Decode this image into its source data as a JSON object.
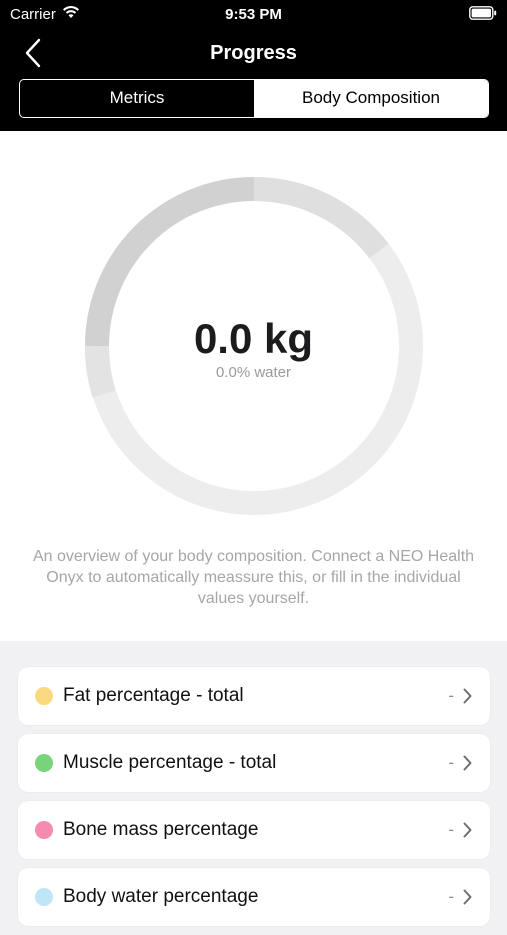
{
  "status": {
    "carrier": "Carrier",
    "time": "9:53 PM"
  },
  "nav": {
    "title": "Progress"
  },
  "segments": [
    {
      "label": "Metrics",
      "selected": false
    },
    {
      "label": "Body Composition",
      "selected": true
    }
  ],
  "summary": {
    "value": "0.0 kg",
    "subtitle": "0.0% water",
    "description": "An overview of your body composition. Connect a NEO Health Onyx to automatically meassure this, or fill in the individual values yourself."
  },
  "metrics": [
    {
      "label": "Fat percentage - total",
      "value": "-",
      "color": "#fbd97e"
    },
    {
      "label": "Muscle percentage - total",
      "value": "-",
      "color": "#79d37b"
    },
    {
      "label": "Bone mass percentage",
      "value": "-",
      "color": "#f58bb0"
    },
    {
      "label": "Body water percentage",
      "value": "-",
      "color": "#bfe6f7"
    }
  ]
}
